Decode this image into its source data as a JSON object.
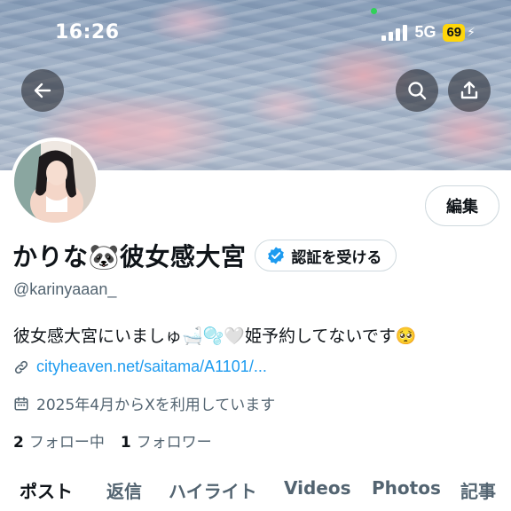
{
  "status_bar": {
    "time": "16:26",
    "network": "5G",
    "battery": "69"
  },
  "header": {
    "back_icon": "arrow-left-icon",
    "search_icon": "search-icon",
    "share_icon": "share-icon"
  },
  "profile": {
    "edit_label": "編集",
    "display_name": "かりな🐼彼女感大宮",
    "verify_label": "認証を受ける",
    "handle": "@karinyaaan_",
    "bio": "彼女感大宮にいましゅ🛁🫧🤍姫予約してないです🥺",
    "link": "cityheaven.net/saitama/A1101/...",
    "joined": "2025年4月からXを利用しています",
    "following_count": "2",
    "following_label": "フォロー中",
    "followers_count": "1",
    "followers_label": "フォロワー"
  },
  "tabs": [
    {
      "label": "ポスト",
      "active": true
    },
    {
      "label": "返信"
    },
    {
      "label": "ハイライト"
    },
    {
      "label": "Videos"
    },
    {
      "label": "Photos"
    },
    {
      "label": "記事"
    }
  ],
  "colors": {
    "accent": "#1d9bf0",
    "verified": "#1d9bf0",
    "muted": "#536471",
    "battery": "#ffd60a"
  }
}
